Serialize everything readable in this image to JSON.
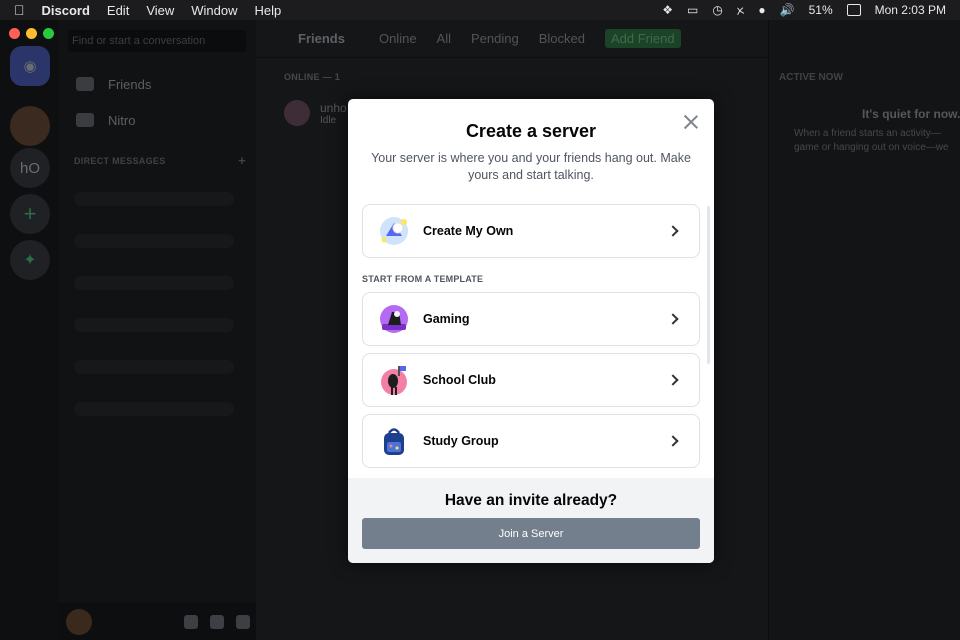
{
  "menubar": {
    "app_name": "Discord",
    "menus": [
      "Edit",
      "View",
      "Window",
      "Help"
    ],
    "battery": "51%",
    "clock": "Mon 2:03 PM"
  },
  "background": {
    "search_placeholder": "Find or start a conversation",
    "nav_friends": "Friends",
    "nav_nitro": "Nitro",
    "direct_messages_header": "DIRECT MESSAGES",
    "add_dm": "+",
    "guild_initials": "hO",
    "topbar": {
      "title": "Friends",
      "tabs": [
        "Online",
        "All",
        "Pending",
        "Blocked"
      ],
      "add_friend": "Add Friend"
    },
    "online_label": "ONLINE — 1",
    "friend": {
      "name": "unho",
      "status": "Idle"
    },
    "active_now": {
      "header": "ACTIVE NOW",
      "quiet_title": "It's quiet for now...",
      "quiet_desc_1": "When a friend starts an activity—",
      "quiet_desc_2": "game or hanging out on voice—we"
    }
  },
  "modal": {
    "title": "Create a server",
    "subtitle": "Your server is where you and your friends hang out. Make yours and start talking.",
    "create_own": "Create My Own",
    "template_header": "START FROM A TEMPLATE",
    "templates": [
      "Gaming",
      "School Club",
      "Study Group"
    ],
    "footer_title": "Have an invite already?",
    "join_button": "Join a Server"
  },
  "colors": {
    "join_button": "#747f8d",
    "discord_blurple": "#5865f2",
    "add_friend_green": "#1c4327"
  }
}
